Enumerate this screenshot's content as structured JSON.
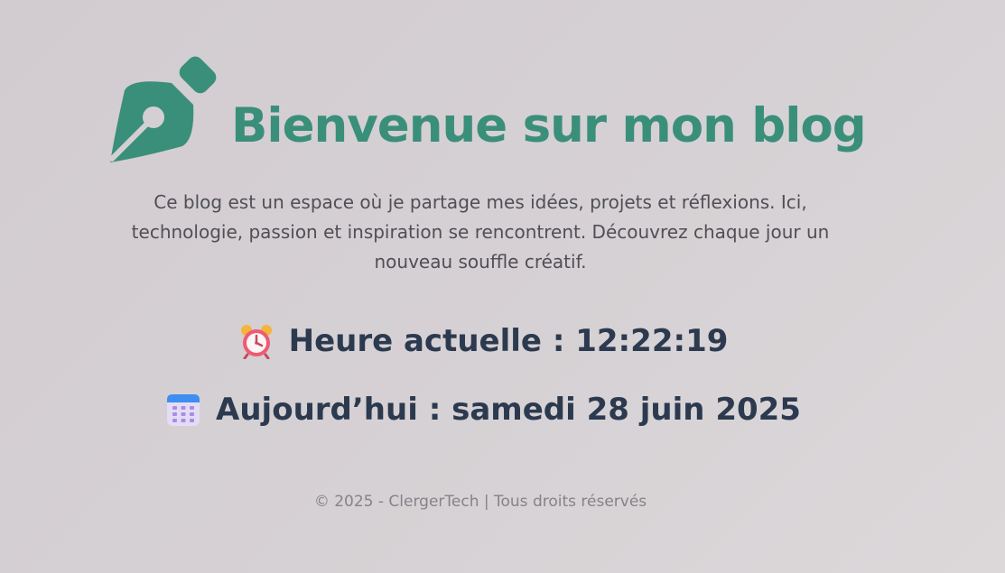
{
  "brand": {
    "accent_color": "#3a8f7a",
    "icon": "fountain-pen-icon"
  },
  "header": {
    "title": "Bienvenue sur mon blog"
  },
  "intro": {
    "text": "Ce blog est un espace où je partage mes idées, projets et réflexions. Ici, technologie, passion et inspiration se rencontrent. Découvrez chaque jour un nouveau souffle créatif."
  },
  "time": {
    "icon": "alarm-clock-icon",
    "label": "Heure actuelle : 12:22:19"
  },
  "date": {
    "icon": "calendar-icon",
    "label": "Aujourd’hui : samedi 28 juin 2025"
  },
  "footer": {
    "text": "© 2025 - ClergerTech | Tous droits réservés"
  }
}
